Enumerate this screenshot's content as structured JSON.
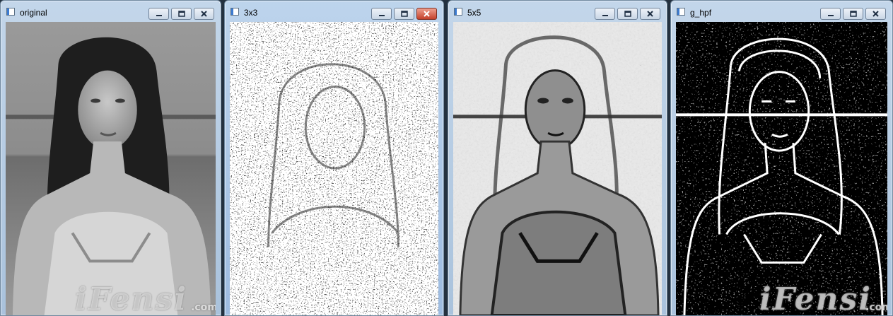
{
  "windows": [
    {
      "title": "original",
      "active": false
    },
    {
      "title": "3x3",
      "active": true
    },
    {
      "title": "5x5",
      "active": false
    },
    {
      "title": "g_hpf",
      "active": false
    }
  ],
  "watermark": {
    "text": "iFensi",
    "suffix": ".com"
  },
  "icons": {
    "app": "app-window-icon",
    "minimize": "minimize-icon",
    "maximize": "maximize-icon",
    "close": "close-icon"
  }
}
